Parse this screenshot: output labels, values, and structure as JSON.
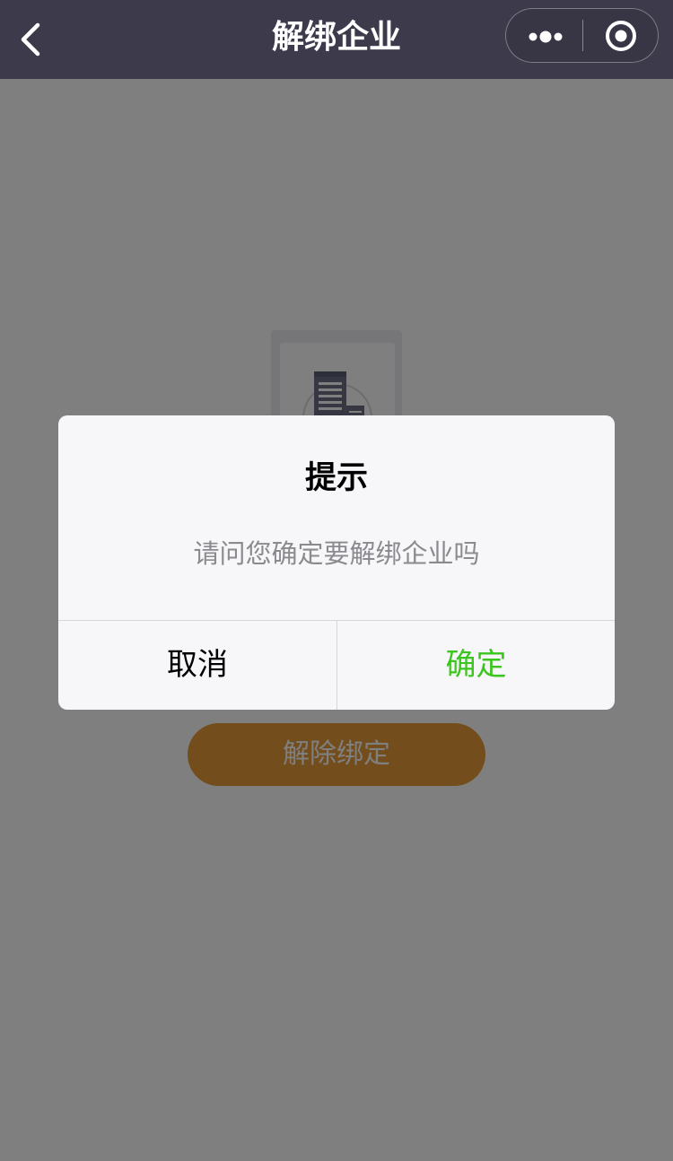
{
  "navbar": {
    "title": "解绑企业",
    "background_color": "#3d3a4b",
    "back_icon": "chevron-left-icon",
    "more_icon": "more-dots-icon",
    "close_icon": "target-circle-icon"
  },
  "page": {
    "illustration_icon": "company-building-icon",
    "unbind_button_label": "解除绑定",
    "unbind_button_color": "#e79a36"
  },
  "modal": {
    "title": "提示",
    "message": "请问您确定要解绑企业吗",
    "cancel_label": "取消",
    "confirm_label": "确定",
    "confirm_color": "#3cc51f"
  }
}
